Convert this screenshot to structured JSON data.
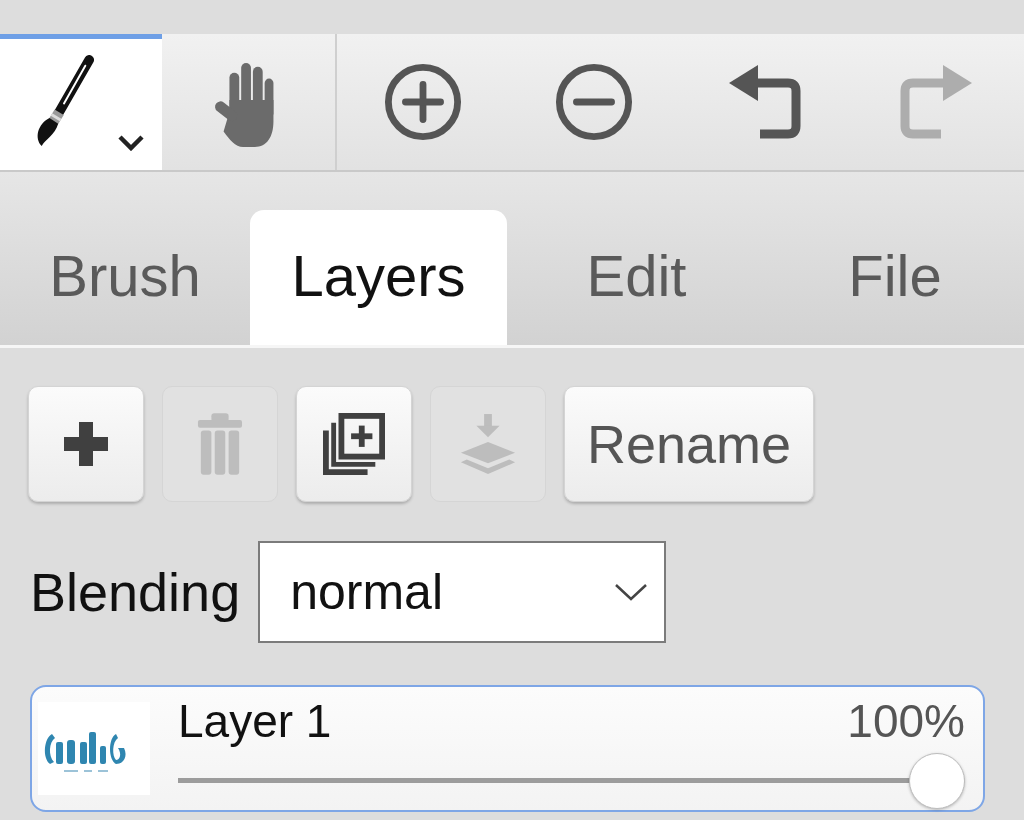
{
  "toolbar": {
    "tools": [
      {
        "kind": "brush",
        "selected": true
      },
      {
        "kind": "hand",
        "selected": false
      }
    ],
    "actions": [
      {
        "kind": "zoom_in",
        "disabled": false
      },
      {
        "kind": "zoom_out",
        "disabled": false
      },
      {
        "kind": "undo",
        "disabled": false
      },
      {
        "kind": "redo",
        "disabled": true
      }
    ]
  },
  "tabs": [
    {
      "label": "Brush",
      "selected": false
    },
    {
      "label": "Layers",
      "selected": true
    },
    {
      "label": "Edit",
      "selected": false
    },
    {
      "label": "File",
      "selected": false
    }
  ],
  "layer_actions": [
    {
      "kind": "add",
      "disabled": false
    },
    {
      "kind": "delete",
      "disabled": true
    },
    {
      "kind": "duplicate",
      "disabled": false
    },
    {
      "kind": "merge_down",
      "disabled": true
    },
    {
      "kind": "rename",
      "label": "Rename",
      "disabled": false
    }
  ],
  "blending": {
    "label": "Blending",
    "value": "normal"
  },
  "layers": [
    {
      "name": "Layer 1",
      "opacity": "100%",
      "level": 1,
      "selected": true
    }
  ]
}
